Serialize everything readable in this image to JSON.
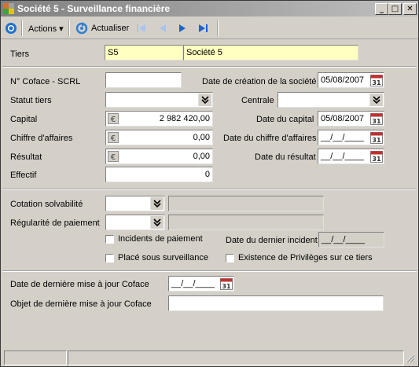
{
  "window": {
    "title": "Société 5 - Surveillance financière",
    "buttons": {
      "minimize": "_",
      "maximize": "□",
      "close": "✕"
    }
  },
  "toolbar": {
    "actions_label": "Actions",
    "refresh_label": "Actualiser"
  },
  "tiers": {
    "label": "Tiers",
    "code": "S5",
    "name": "Société 5"
  },
  "coface": {
    "numero_label": "N° Coface - SCRL",
    "numero_value": "",
    "date_creation_label": "Date de création de la société",
    "date_creation_value": "05/08/2007",
    "statut_label": "Statut tiers",
    "statut_value": "",
    "centrale_label": "Centrale",
    "centrale_value": "",
    "capital_label": "Capital",
    "capital_value": "2 982 420,00",
    "date_capital_label": "Date du capital",
    "date_capital_value": "05/08/2007",
    "ca_label": "Chiffre d'affaires",
    "ca_value": "0,00",
    "date_ca_label": "Date du chiffre d'affaires",
    "date_ca_value": "__/__/____",
    "resultat_label": "Résultat",
    "resultat_value": "0,00",
    "date_resultat_label": "Date du résultat",
    "date_resultat_value": "__/__/____",
    "effectif_label": "Effectif",
    "effectif_value": "0"
  },
  "solvabilite": {
    "cotation_label": "Cotation solvabilité",
    "cotation_value": "",
    "cotation_desc": "",
    "regularite_label": "Régularité de paiement",
    "regularite_value": "",
    "regularite_desc": "",
    "incidents_label": "Incidents de paiement",
    "incidents_checked": false,
    "date_incident_label": "Date du dernier incident",
    "date_incident_value": "__/__/____",
    "surveillance_label": "Placé sous surveillance",
    "surveillance_checked": false,
    "privileges_label": "Existence de Privilèges sur ce tiers",
    "privileges_checked": false
  },
  "maj": {
    "date_label": "Date de dernière mise à jour Coface",
    "date_value": "__/__/____",
    "objet_label": "Objet de dernière mise à jour Coface",
    "objet_value": ""
  },
  "icons": {
    "calendar_text": "31",
    "currency_text": "€"
  },
  "colors": {
    "window_bg": "#d4d0c8",
    "title_gradient_start": "#808080",
    "required_field": "#ffffc0",
    "calendar_red": "#c03030",
    "nav_blue": "#2060d0"
  }
}
